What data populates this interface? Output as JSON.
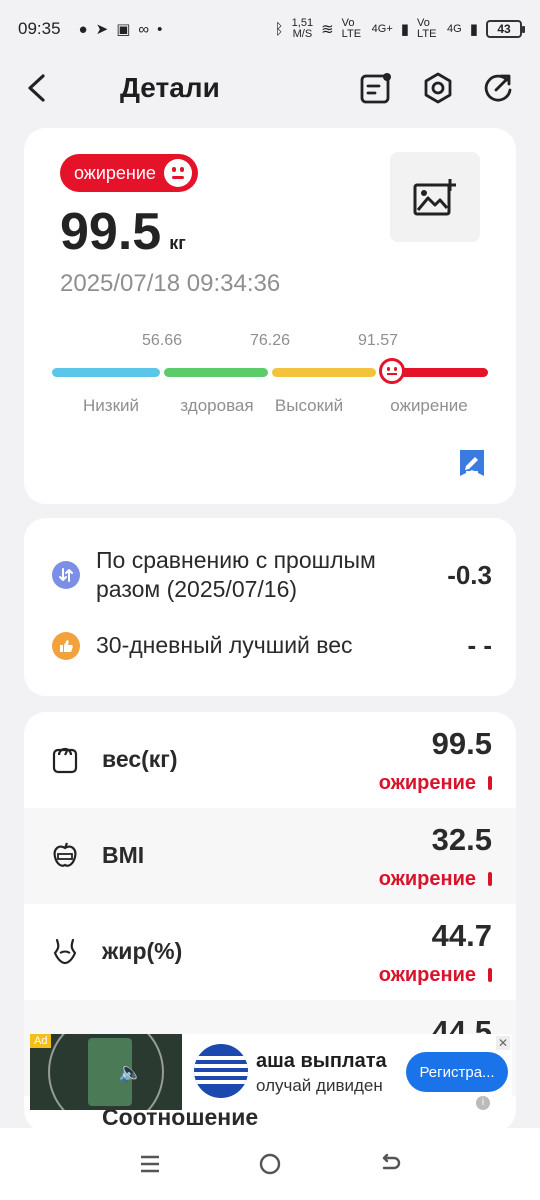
{
  "status_bar": {
    "time": "09:35",
    "net_speed": "1,51",
    "net_unit": "M/S",
    "volte1": "Vo LTE",
    "net1": "4G+",
    "volte2": "Vo LTE",
    "net2": "4G",
    "battery": "43"
  },
  "header": {
    "title": "Детали",
    "icons": [
      "back-arrow-icon",
      "report-icon",
      "settings-hexagon-icon",
      "share-refresh-icon"
    ]
  },
  "summary": {
    "badge_label": "ожирение",
    "weight": "99.5",
    "unit": "кг",
    "datetime": "2025/07/18 09:34:36",
    "scale": {
      "thresholds": [
        "56.66",
        "76.26",
        "91.57"
      ],
      "categories": [
        "Низкий",
        "здоровая",
        "Высокий",
        "ожирение"
      ],
      "colors": [
        "#5bc6e8",
        "#5ccb6a",
        "#f4c33e",
        "#e5132a"
      ],
      "current_position_fraction": 0.78
    }
  },
  "comparison": {
    "prev_label": "По сравнению с прошлым разом (2025/07/16)",
    "prev_value": "-0.3",
    "best_label": "30-дневный лучший вес",
    "best_value": "- -"
  },
  "metrics": [
    {
      "label": "вес(кг)",
      "value": "99.5",
      "status": "ожирение",
      "icon": "scale-icon"
    },
    {
      "label": "BMI",
      "value": "32.5",
      "status": "ожирение",
      "icon": "apple-tape-icon"
    },
    {
      "label": "жир(%)",
      "value": "44.7",
      "status": "ожирение",
      "icon": "body-fat-icon"
    },
    {
      "label": "Соотношение",
      "value": "44.5",
      "icon": "ratio-icon"
    }
  ],
  "ad": {
    "tag": "Ad",
    "title": "аша выплата ",
    "subtitle": "олучай дивиден",
    "cta": "Регистра..."
  },
  "colors": {
    "accent_red": "#e5132a",
    "card_bg": "#ffffff",
    "page_bg": "#f2f2f4"
  }
}
